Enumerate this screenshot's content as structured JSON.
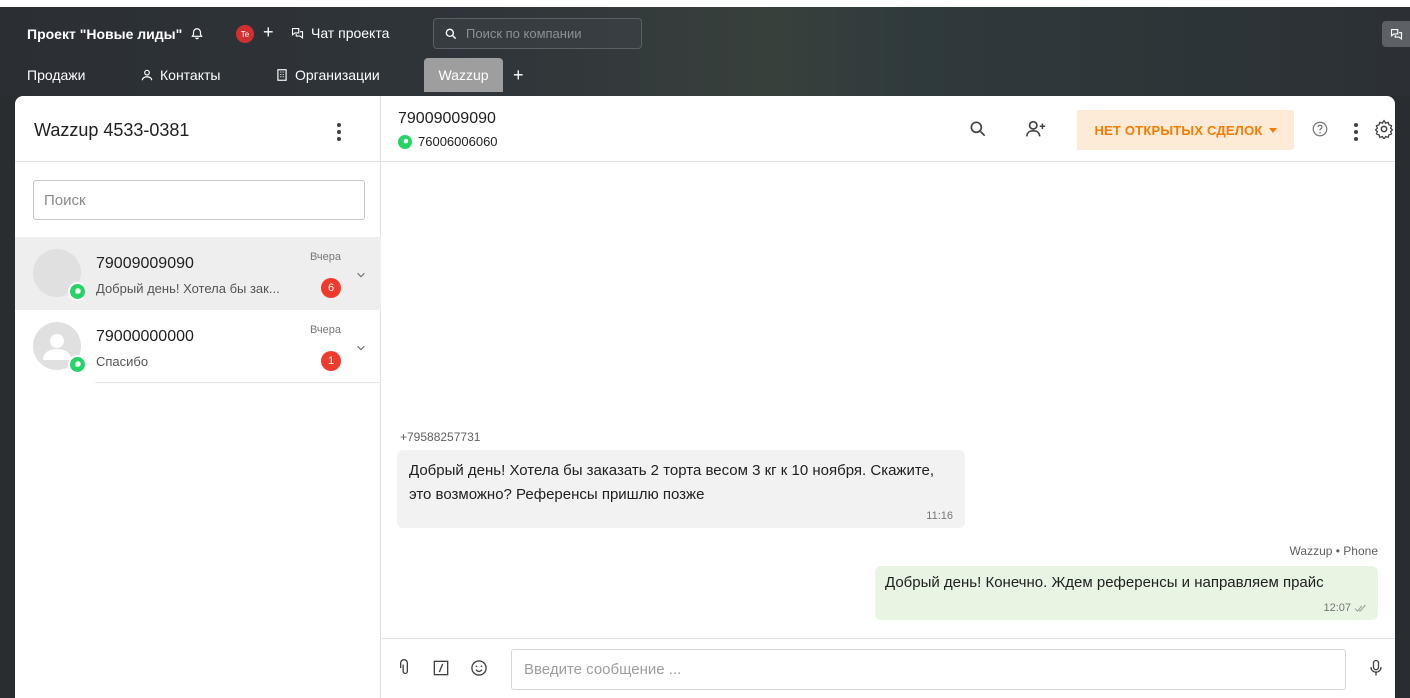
{
  "topbar": {
    "project_title": "Проект \"Новые лиды\"",
    "user_initials": "Te",
    "chat_project_label": "Чат проекта",
    "search_placeholder": "Поиск по компании",
    "tabs": [
      {
        "label": "Продажи"
      },
      {
        "label": "Контакты"
      },
      {
        "label": "Организации"
      },
      {
        "label": "Wazzup"
      }
    ]
  },
  "sidebar": {
    "title": "Wazzup 4533-0381",
    "search_placeholder": "Поиск",
    "conversations": [
      {
        "name": "79009009090",
        "last_message": "Добрый день! Хотела бы зак...",
        "time": "Вчера",
        "unread": "6"
      },
      {
        "name": "79000000000",
        "last_message": "Спасибо",
        "time": "Вчера",
        "unread": "1"
      }
    ]
  },
  "chat": {
    "contact_name": "79009009090",
    "contact_phone": "76006006060",
    "deals_label": "НЕТ ОТКРЫТЫХ СДЕЛОК",
    "messages": [
      {
        "sender": "+79588257731",
        "text": "Добрый день! Хотела бы заказать 2 торта весом 3 кг к 10 ноября. Скажите, это возможно? Референсы пришлю позже",
        "time": "11:16"
      },
      {
        "sender": "Wazzup • Phone",
        "text": "Добрый день! Конечно. Ждем референсы и направляем прайс",
        "time": "12:07"
      }
    ],
    "composer_placeholder": "Введите сообщение ..."
  },
  "colors": {
    "accent_orange": "#f57c00",
    "whatsapp_green": "#25d366",
    "unread_red": "#ef3b2d",
    "outgoing_bubble": "#e8f5e3"
  }
}
